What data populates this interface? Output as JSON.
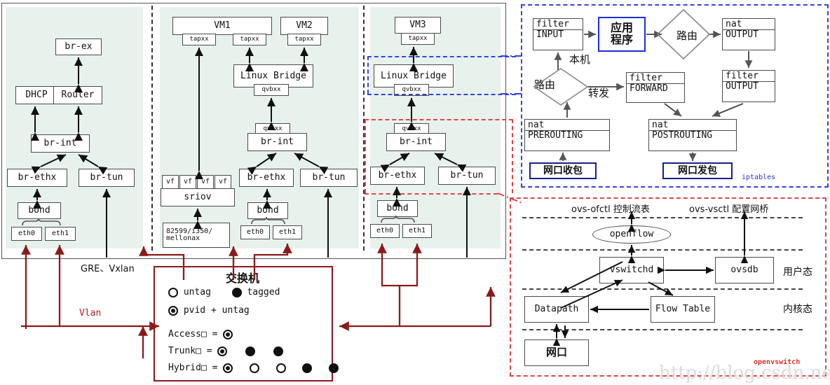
{
  "panels": {
    "p1": {
      "nodes": {
        "br_ex": "br-ex",
        "dhcp": "DHCP",
        "router": "Router",
        "br_int": "br-int",
        "br_ethx": "br-ethx",
        "br_tun": "br-tun",
        "bond": "bond",
        "eth0": "eth0",
        "eth1": "eth1"
      }
    },
    "p2": {
      "nodes": {
        "vm1": "VM1",
        "vm2": "VM2",
        "tap1": "tapxx",
        "tap2": "tapxx",
        "tap3": "tapxx",
        "linux_bridge": "Linux Bridge",
        "qvbxx": "qvbxx",
        "qvoxx": "qvoxx",
        "br_int": "br-int",
        "br_ethx": "br-ethx",
        "br_tun": "br-tun",
        "bond": "bond",
        "eth0": "eth0",
        "eth1": "eth1",
        "vf": "vf",
        "sriov": "sriov",
        "nic_l1": "82599/i350/",
        "nic_l2": "mellonax"
      }
    },
    "p3": {
      "nodes": {
        "vm3": "VM3",
        "tap": "tapxx",
        "linux_bridge": "Linux Bridge",
        "qvbxx": "qvbxx",
        "qvoxx": "qvoxx",
        "br_int": "br-int",
        "br_ethx": "br-ethx",
        "br_tun": "br-tun",
        "bond": "bond",
        "eth0": "eth0",
        "eth1": "eth1"
      }
    }
  },
  "labels": {
    "gre_vxlan": "GRE、Vxlan",
    "vlan": "Vlan"
  },
  "switch": {
    "title": "交换机",
    "untag": "untag",
    "tagged": "tagged",
    "pvid_untag": "pvid + untag",
    "access": "Access□ =",
    "trunk": "Trunk□  =",
    "hybrid": "Hybrid□ ="
  },
  "iptables": {
    "tag": "iptables",
    "filter_input_t": "filter",
    "filter_input_b": "INPUT",
    "app": "应用\n程序",
    "app_l1": "应用",
    "app_l2": "程序",
    "route_top": "路由",
    "route_bottom": "路由",
    "nat_output_t": "nat",
    "nat_output_b": "OUTPUT",
    "filter_output_t": "filter",
    "filter_output_b": "OUTPUT",
    "filter_forward_t": "filter",
    "filter_forward_b": "FORWARD",
    "nat_pre_t": "nat",
    "nat_pre_b": "PREROUTING",
    "nat_post_t": "nat",
    "nat_post_b": "POSTROUTING",
    "rx": "网口收包",
    "tx": "网口发包",
    "local": "本机",
    "forward": "转发"
  },
  "openvswitch": {
    "tag": "openvswitch",
    "ofctl": "ovs-ofctl 控制流表",
    "vsctl": "ovs-vsctl 配置网桥",
    "openflow": "openflow",
    "vswitchd": "vswitchd",
    "ovsdb": "ovsdb",
    "datapath": "Datapath",
    "flow_table": "Flow Table",
    "netport": "网口",
    "userspace": "用户态",
    "kernelspace": "内核态"
  },
  "watermark": "http://blog.csdn.net/",
  "colors": {
    "panel_green": "#e8f2ed",
    "red": "#8b1a1a",
    "blue": "#2233cc",
    "dash_red": "#e04545"
  }
}
